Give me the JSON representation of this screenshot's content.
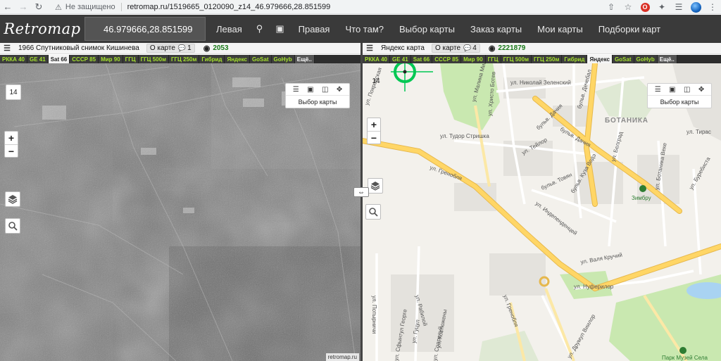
{
  "browser": {
    "security_label": "Не защищено",
    "url": "retromap.ru/1519665_0120090_z14_46.979666,28.851599"
  },
  "topnav": {
    "logo": "Retromap",
    "coords": "46.979666,28.851599",
    "items": [
      "Левая",
      "Правая",
      "Что там?",
      "Выбор карты",
      "Заказ карты",
      "Мои карты",
      "Подборки карт"
    ]
  },
  "left": {
    "title": "1966 Спутниковый снимок Кишинева",
    "on_map": "О карте",
    "comments": "1",
    "views": "2053",
    "tabs": [
      "РККА 40",
      "GE 41",
      "Sat 66",
      "СССР 85",
      "Мир 90",
      "ГГЦ",
      "ГГЦ 500м",
      "ГГЦ 250м",
      "Гибрид",
      "Яндекс",
      "GoSat",
      "GoHyb",
      "Ещё.."
    ],
    "active_tab": "Sat 66",
    "zoom": "14",
    "map_select": "Выбор карты",
    "attribution": "retromap.ru"
  },
  "right": {
    "title": "Яндекс карта",
    "on_map": "О карте",
    "comments": "4",
    "views": "2221879",
    "tabs": [
      "РККА 40",
      "GE 41",
      "Sat 66",
      "СССР 85",
      "Мир 90",
      "ГГЦ",
      "ГГЦ 500м",
      "ГГЦ 250м",
      "Гибрид",
      "Яндекс",
      "GoSat",
      "GoHyb",
      "Ещё.."
    ],
    "active_tab": "Яндекс",
    "zoom": "14",
    "map_select": "Выбор карты",
    "labels": {
      "botanika": "БОТАНИКА",
      "grenoble": "ул. Гренобля",
      "grenoble2": "ул. Гренобля",
      "valya": "ул. Валя Кручий",
      "dachia": "бульв. Дачия",
      "dachia2": "бульв. Дачия",
      "dechebal": "бульв. Дечебал",
      "independentsei": "ул. Индепенденцей",
      "kuza_vode": "бульв. Куза Водэ",
      "tudor": "ул. Тудор Стришка",
      "nikolai": "ул. Николай Зеленский",
      "hristo": "ул. Христо Ботев",
      "teilor": "ул. Тейлор",
      "tolbi": "бульв. Товян",
      "beograd": "ул. Белград",
      "nufer": "ул. Нуферилор",
      "drumul": "ул. Друмул Виилор",
      "poturnich": "ул. Потырничи",
      "malina": "ул. Малина Мик",
      "tiras": "ул. Тирас",
      "burebista": "ул. Буребиста",
      "botanika_veche": "ул. Ботаника Веке",
      "zimbru": "Зимбру",
      "muzei": "Парк Музей Села",
      "pokrovskaya": "ул. Покровская",
      "sfantul": "ул. Сфынтул Георге",
      "kostyuzheny": "ул. Костюжены",
      "gutsul": "ул. Гуцул",
      "palatul": "ул. Рабилой",
      "soarelui": "ул. Соарелуй"
    }
  },
  "colors": {
    "nav_bg": "#3a3a3a",
    "tab_green": "#a6e22e",
    "road_yellow": "#ffd666",
    "park_green": "#c9e8b0",
    "water": "#a9d3f2"
  }
}
